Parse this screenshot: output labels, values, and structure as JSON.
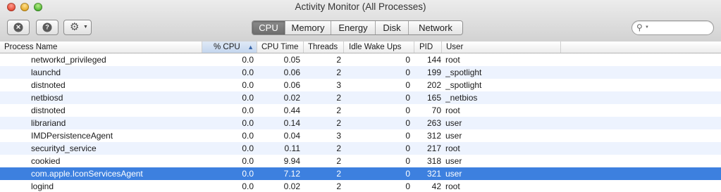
{
  "window": {
    "title": "Activity Monitor (All Processes)"
  },
  "toolbar": {
    "quit_icon": "stop-process-icon",
    "info_icon": "inspect-process-icon",
    "action_icon": "gear-icon",
    "tabs": [
      {
        "label": "CPU",
        "active": true
      },
      {
        "label": "Memory",
        "active": false
      },
      {
        "label": "Energy",
        "active": false
      },
      {
        "label": "Disk",
        "active": false
      },
      {
        "label": "Network",
        "active": false
      }
    ],
    "search_placeholder": ""
  },
  "table": {
    "columns": [
      "Process Name",
      "% CPU",
      "CPU Time",
      "Threads",
      "Idle Wake Ups",
      "PID",
      "User"
    ],
    "sorted_column": "% CPU",
    "sort_direction": "ascending",
    "rows": [
      {
        "name": "networkd_privileged",
        "cpu": "0.0",
        "cpu_time": "0.05",
        "threads": "2",
        "idle_wake_ups": "0",
        "pid": "144",
        "user": "root"
      },
      {
        "name": "launchd",
        "cpu": "0.0",
        "cpu_time": "0.06",
        "threads": "2",
        "idle_wake_ups": "0",
        "pid": "199",
        "user": "_spotlight"
      },
      {
        "name": "distnoted",
        "cpu": "0.0",
        "cpu_time": "0.06",
        "threads": "3",
        "idle_wake_ups": "0",
        "pid": "202",
        "user": "_spotlight"
      },
      {
        "name": "netbiosd",
        "cpu": "0.0",
        "cpu_time": "0.02",
        "threads": "2",
        "idle_wake_ups": "0",
        "pid": "165",
        "user": "_netbios"
      },
      {
        "name": "distnoted",
        "cpu": "0.0",
        "cpu_time": "0.44",
        "threads": "2",
        "idle_wake_ups": "0",
        "pid": "70",
        "user": "root"
      },
      {
        "name": "librariand",
        "cpu": "0.0",
        "cpu_time": "0.14",
        "threads": "2",
        "idle_wake_ups": "0",
        "pid": "263",
        "user": "user"
      },
      {
        "name": "IMDPersistenceAgent",
        "cpu": "0.0",
        "cpu_time": "0.04",
        "threads": "3",
        "idle_wake_ups": "0",
        "pid": "312",
        "user": "user"
      },
      {
        "name": "securityd_service",
        "cpu": "0.0",
        "cpu_time": "0.11",
        "threads": "2",
        "idle_wake_ups": "0",
        "pid": "217",
        "user": "root"
      },
      {
        "name": "cookied",
        "cpu": "0.0",
        "cpu_time": "9.94",
        "threads": "2",
        "idle_wake_ups": "0",
        "pid": "318",
        "user": "user"
      },
      {
        "name": "com.apple.IconServicesAgent",
        "cpu": "0.0",
        "cpu_time": "7.12",
        "threads": "2",
        "idle_wake_ups": "0",
        "pid": "321",
        "user": "user",
        "selected": true
      },
      {
        "name": "logind",
        "cpu": "0.0",
        "cpu_time": "0.02",
        "threads": "2",
        "idle_wake_ups": "0",
        "pid": "42",
        "user": "root"
      }
    ]
  },
  "colors": {
    "selection": "#3d80df",
    "alt_row": "#edf3fe",
    "sorted_header": "#c4d6ee"
  }
}
